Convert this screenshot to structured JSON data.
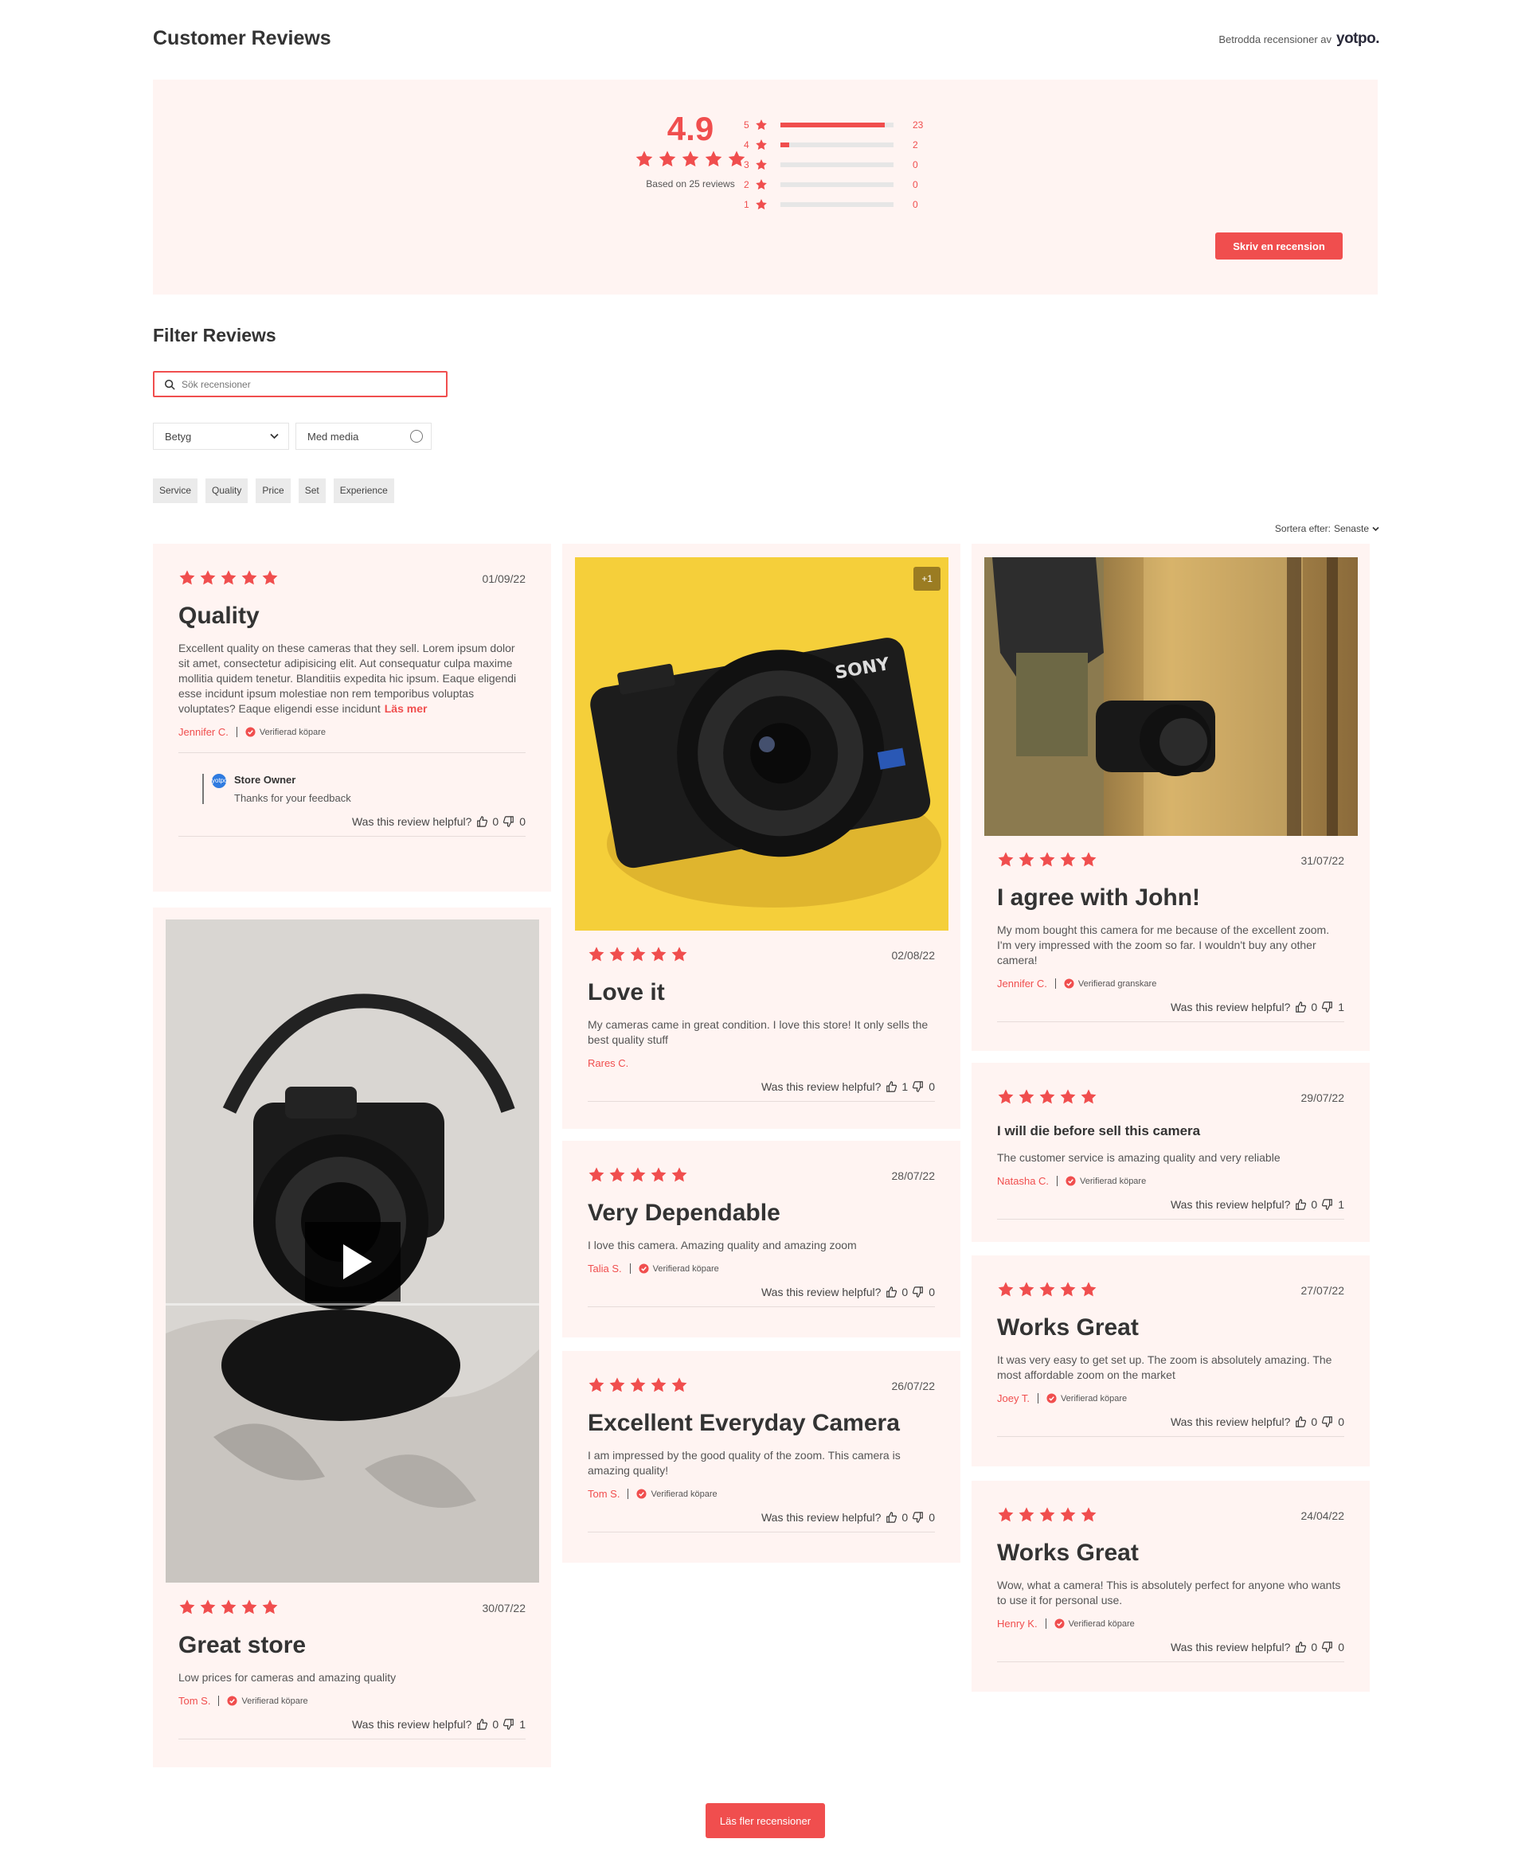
{
  "header": {
    "title": "Customer Reviews",
    "trusted_text": "Betrodda recensioner av",
    "brand": "yotpo."
  },
  "summary": {
    "average": "4.9",
    "based_on": "Based on 25 reviews",
    "write_button": "Skriv en recension",
    "histogram": [
      {
        "level": "5",
        "count": "23",
        "fraction": 0.92
      },
      {
        "level": "4",
        "count": "2",
        "fraction": 0.08
      },
      {
        "level": "3",
        "count": "0",
        "fraction": 0
      },
      {
        "level": "2",
        "count": "0",
        "fraction": 0
      },
      {
        "level": "1",
        "count": "0",
        "fraction": 0
      }
    ]
  },
  "filters": {
    "title": "Filter Reviews",
    "search_placeholder": "Sök recensioner",
    "rating_select": "Betyg",
    "media_toggle": "Med media",
    "tags": [
      "Service",
      "Quality",
      "Price",
      "Set",
      "Experience"
    ]
  },
  "sort": {
    "label": "Sortera efter:",
    "value": "Senaste"
  },
  "helpful_label": "Was this review helpful?",
  "reviews": [
    {
      "date": "01/09/22",
      "title": "Quality",
      "body": "Excellent quality on these cameras that they sell. Lorem ipsum dolor sit amet, consectetur adipisicing elit. Aut consequatur culpa maxime mollitia quidem tenetur. Blanditiis expedita hic ipsum. Eaque eligendi esse incidunt ipsum molestiae non rem temporibus voluptas voluptates?  Eaque eligendi esse incidunt",
      "more": "Läs mer",
      "author": "Jennifer C.",
      "verified": "Verifierad köpare",
      "up": "0",
      "down": "0",
      "owner_name": "Store Owner",
      "owner_text": "Thanks for your feedback",
      "owner_logo": "yotpo"
    },
    {
      "date": "30/07/22",
      "title": "Great store",
      "body": "Low prices for cameras and amazing quality",
      "author": "Tom S.",
      "verified": "Verifierad köpare",
      "up": "0",
      "down": "1"
    },
    {
      "date": "02/08/22",
      "title": "Love it",
      "body": "My cameras came in great condition. I love this store! It only sells the best quality stuff",
      "author": "Rares C.",
      "up": "1",
      "down": "0",
      "media_badge": "+1"
    },
    {
      "date": "28/07/22",
      "title": "Very Dependable",
      "body": "I love this camera. Amazing quality and amazing zoom",
      "author": "Talia S.",
      "verified": "Verifierad köpare",
      "up": "0",
      "down": "0"
    },
    {
      "date": "26/07/22",
      "title": "Excellent Everyday Camera",
      "body": "I am impressed by the good quality of the zoom. This camera is amazing quality!",
      "author": "Tom S.",
      "verified": "Verifierad köpare",
      "up": "0",
      "down": "0"
    },
    {
      "date": "31/07/22",
      "title": "I agree with John!",
      "body": "My mom bought this camera for me because of the excellent zoom. I'm very impressed with the zoom so far. I wouldn't buy any other camera!",
      "author": "Jennifer C.",
      "verified": "Verifierad granskare",
      "up": "0",
      "down": "1"
    },
    {
      "date": "29/07/22",
      "title": "I will die before sell this camera",
      "body": "The customer service is amazing quality and very reliable",
      "author": "Natasha C.",
      "verified": "Verifierad köpare",
      "up": "0",
      "down": "1"
    },
    {
      "date": "27/07/22",
      "title": "Works Great",
      "body": "It was very easy to get set up. The zoom is absolutely amazing. The most affordable zoom on the market",
      "author": "Joey T.",
      "verified": "Verifierad köpare",
      "up": "0",
      "down": "0"
    },
    {
      "date": "24/04/22",
      "title": "Works Great",
      "body": "Wow, what a camera! This is absolutely perfect for anyone who wants to use it for personal use.",
      "author": "Henry K.",
      "verified": "Verifierad köpare",
      "up": "0",
      "down": "0"
    }
  ],
  "load_more": "Läs fler recensioner",
  "colors": {
    "accent": "#f04e4e",
    "card_bg": "#fff4f2"
  },
  "icons": [
    "star-icon",
    "search-icon",
    "chevron-down-icon",
    "verified-icon",
    "thumbs-up-icon",
    "thumbs-down-icon",
    "play-icon"
  ]
}
